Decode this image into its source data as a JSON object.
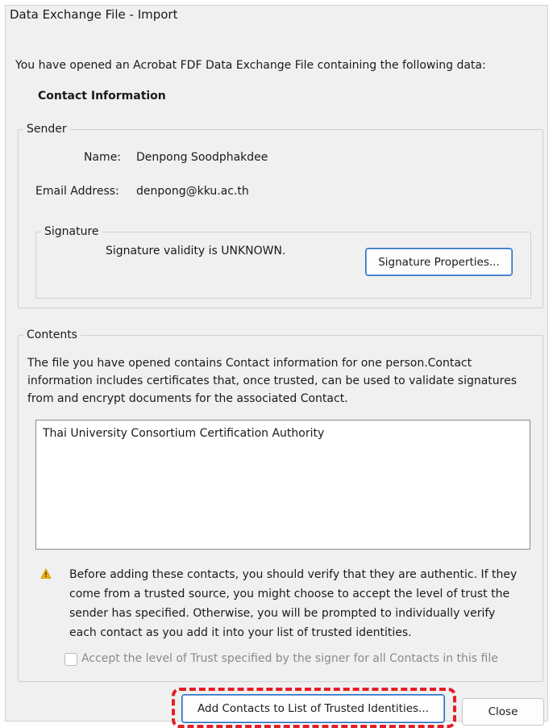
{
  "window": {
    "title": "Data Exchange File - Import"
  },
  "intro_text": "You have opened an Acrobat FDF Data Exchange File containing the following data:",
  "section_heading": "Contact Information",
  "sender": {
    "legend": "Sender",
    "name_label": "Name:",
    "name_value": "Denpong Soodphakdee",
    "email_label": "Email Address:",
    "email_value": "denpong@kku.ac.th",
    "signature": {
      "legend": "Signature",
      "validity_text": "Signature validity is UNKNOWN.",
      "properties_button": "Signature Properties..."
    }
  },
  "contents": {
    "legend": "Contents",
    "description_lines": [
      "The file you have opened contains Contact information for one person.Contact",
      "information includes certificates that, once trusted, can be used to validate signatures",
      "from and encrypt documents for the associated Contact."
    ],
    "list_items": [
      "Thai University Consortium Certification Authority"
    ],
    "warning_icon": "warning-triangle-icon",
    "warning_lines": [
      "Before adding these contacts, you should verify that they are authentic. If they",
      "come from a trusted source, you might choose to accept the level of trust the",
      "sender has specified. Otherwise, you will be prompted to individually verify",
      "each contact as you add it into your list of trusted identities."
    ],
    "accept_trust_checkbox": {
      "label": "Accept the level of Trust specified by the signer for all Contacts in this file",
      "checked": false,
      "enabled": false
    }
  },
  "buttons": {
    "add_contacts": "Add Contacts to List of Trusted Identities...",
    "close": "Close"
  },
  "colors": {
    "highlight": "#e21f26",
    "focus": "#2b6dc2",
    "warning_icon": "#f2b300"
  }
}
